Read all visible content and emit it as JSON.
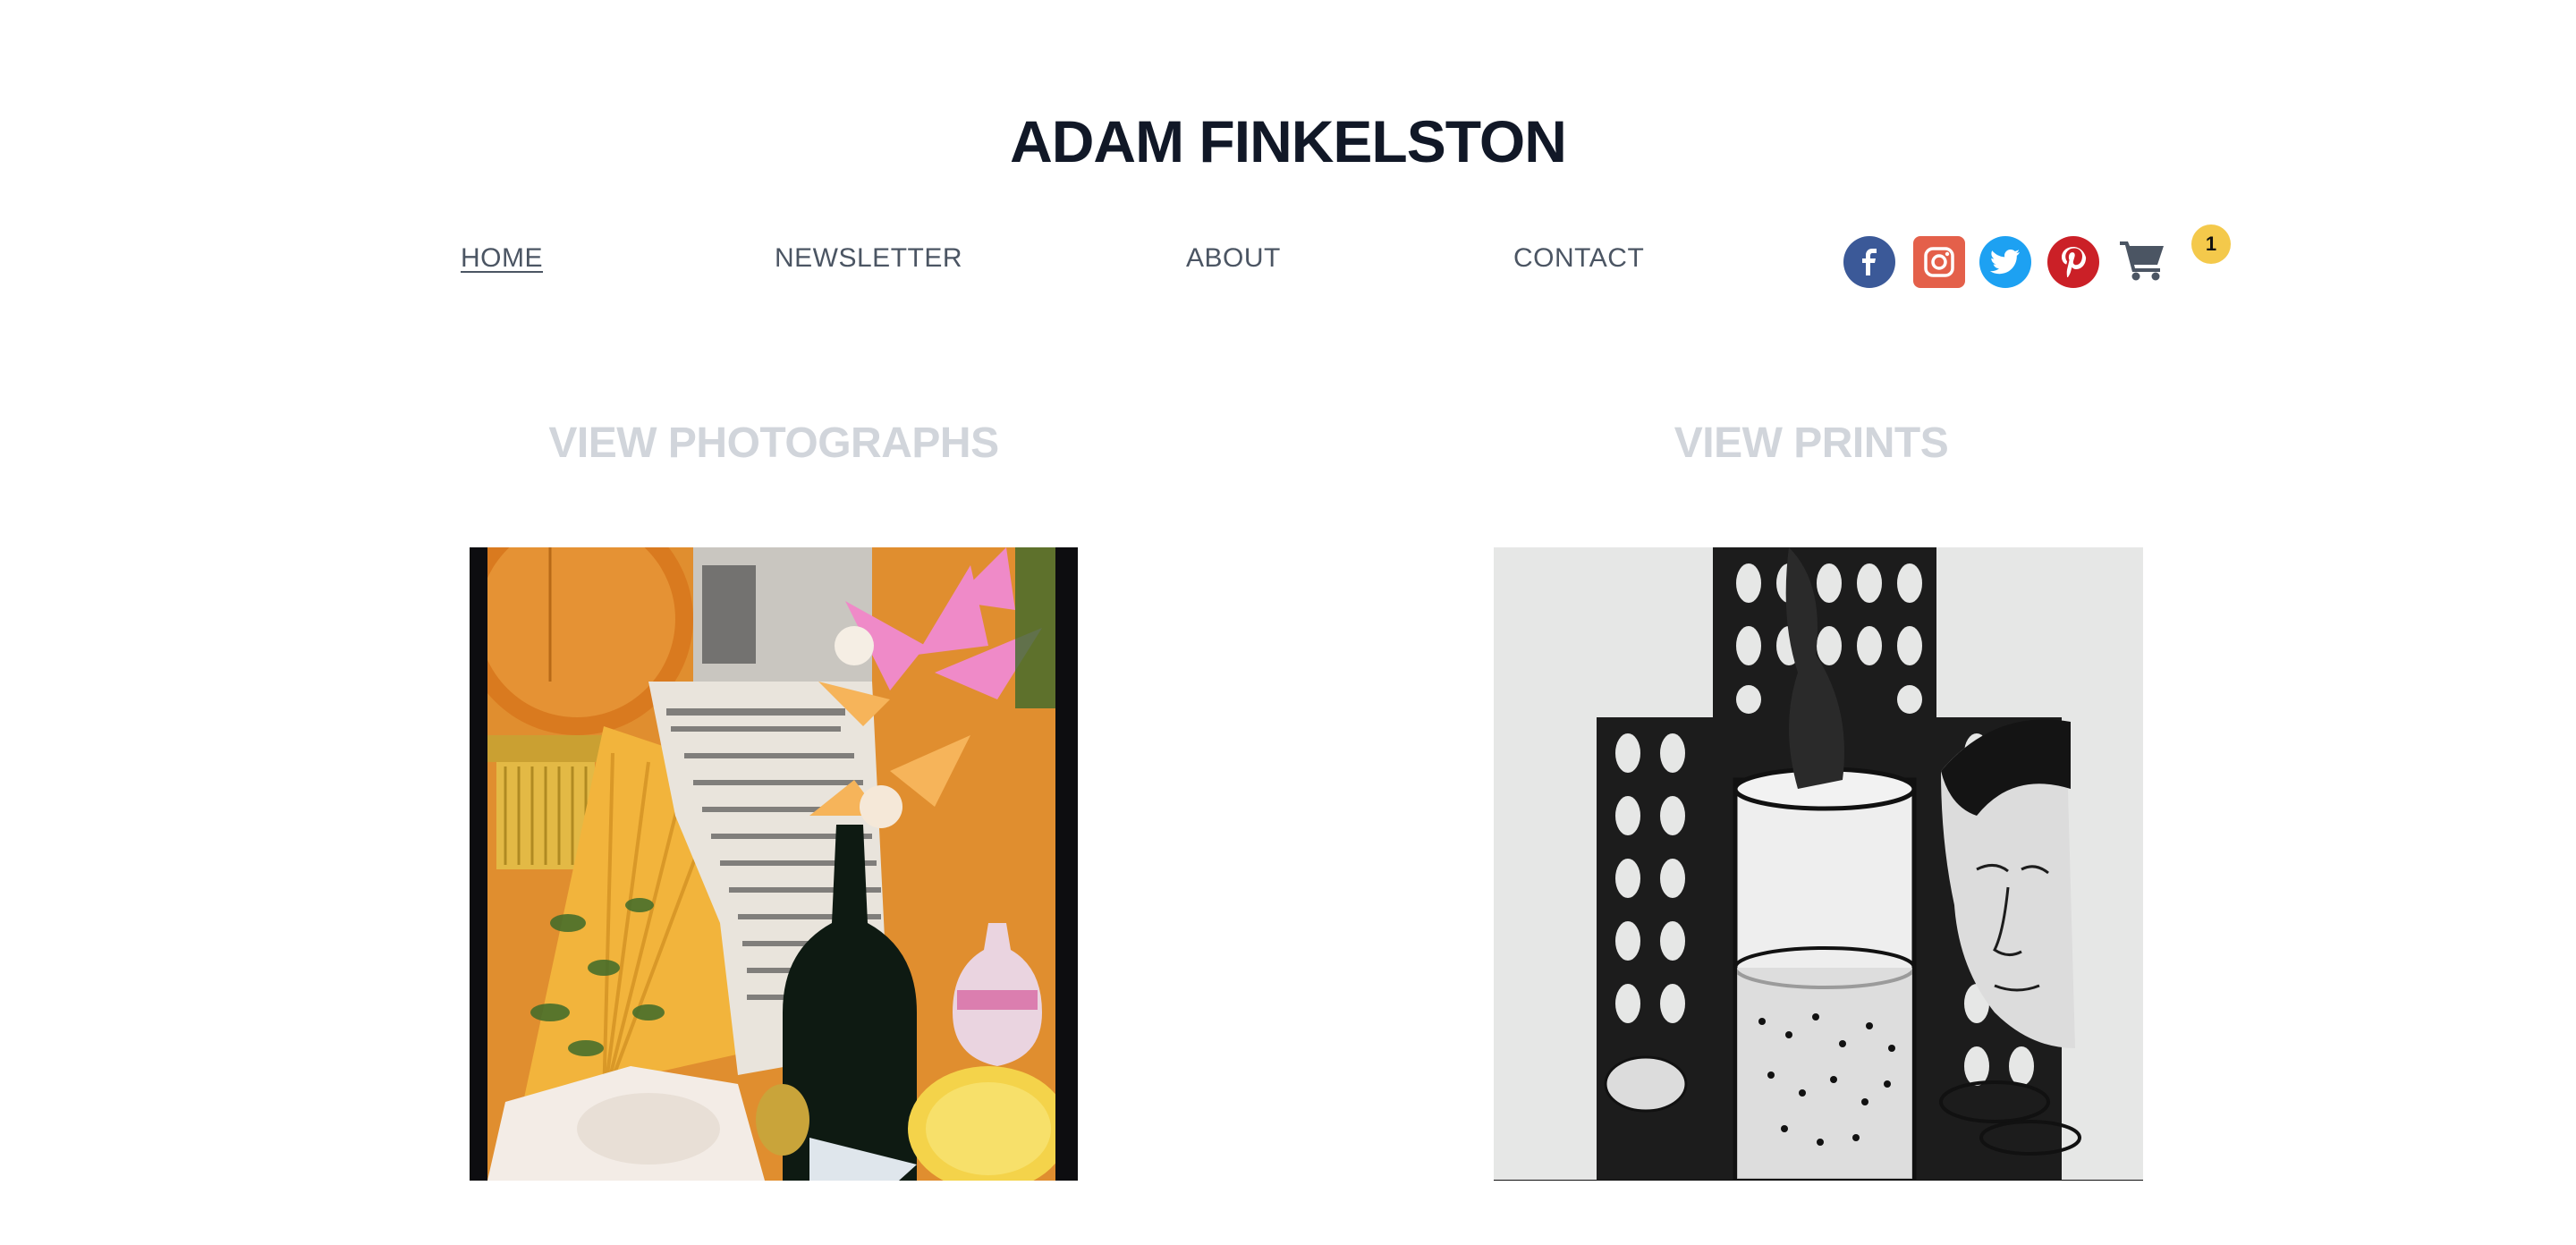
{
  "site": {
    "title": "ADAM FINKELSTON"
  },
  "nav": {
    "items": [
      {
        "label": "HOME",
        "active": true
      },
      {
        "label": "NEWSLETTER"
      },
      {
        "label": "ABOUT"
      },
      {
        "label": "CONTACT"
      }
    ]
  },
  "social": [
    {
      "icon": "facebook-icon",
      "color": "#3b5998"
    },
    {
      "icon": "instagram-icon",
      "color": "#e4604a"
    },
    {
      "icon": "twitter-icon",
      "color": "#1da1f2"
    },
    {
      "icon": "pinterest-icon",
      "color": "#cb2027"
    }
  ],
  "cart": {
    "icon": "cart-icon",
    "count": "1",
    "badge_color": "#f4c94b"
  },
  "gallery": {
    "photographs": {
      "heading": "VIEW PHOTOGRAPHS"
    },
    "prints": {
      "heading": "VIEW PRINTS"
    }
  }
}
